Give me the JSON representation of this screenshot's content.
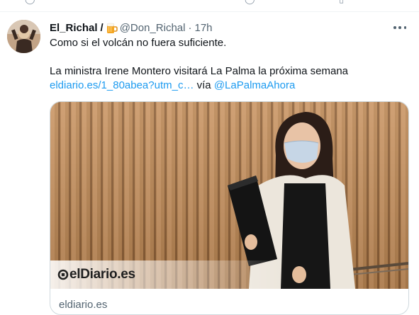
{
  "tweet": {
    "display_name": "El_Richal",
    "separator": "/",
    "handle": "@Don_Richal",
    "dot": "·",
    "time": "17h",
    "lines": [
      "Como si el volcán no fuera suficiente.",
      "La ministra Irene Montero visitará La Palma la próxima semana"
    ],
    "link_text": "eldiario.es/1_80abea?utm_c…",
    "via_text": "vía",
    "mention": "@LaPalmaAhora"
  },
  "card": {
    "logo_text": "elDiario.es",
    "domain": "eldiario.es"
  },
  "icons": {
    "beer": "beer-mug-emoji-icon",
    "more": "more-options-icon",
    "logo_mark": "eldiario-logo-mark-icon"
  },
  "colors": {
    "link": "#1d9bf0",
    "secondary_text": "#536471",
    "border": "#cfd9de"
  }
}
